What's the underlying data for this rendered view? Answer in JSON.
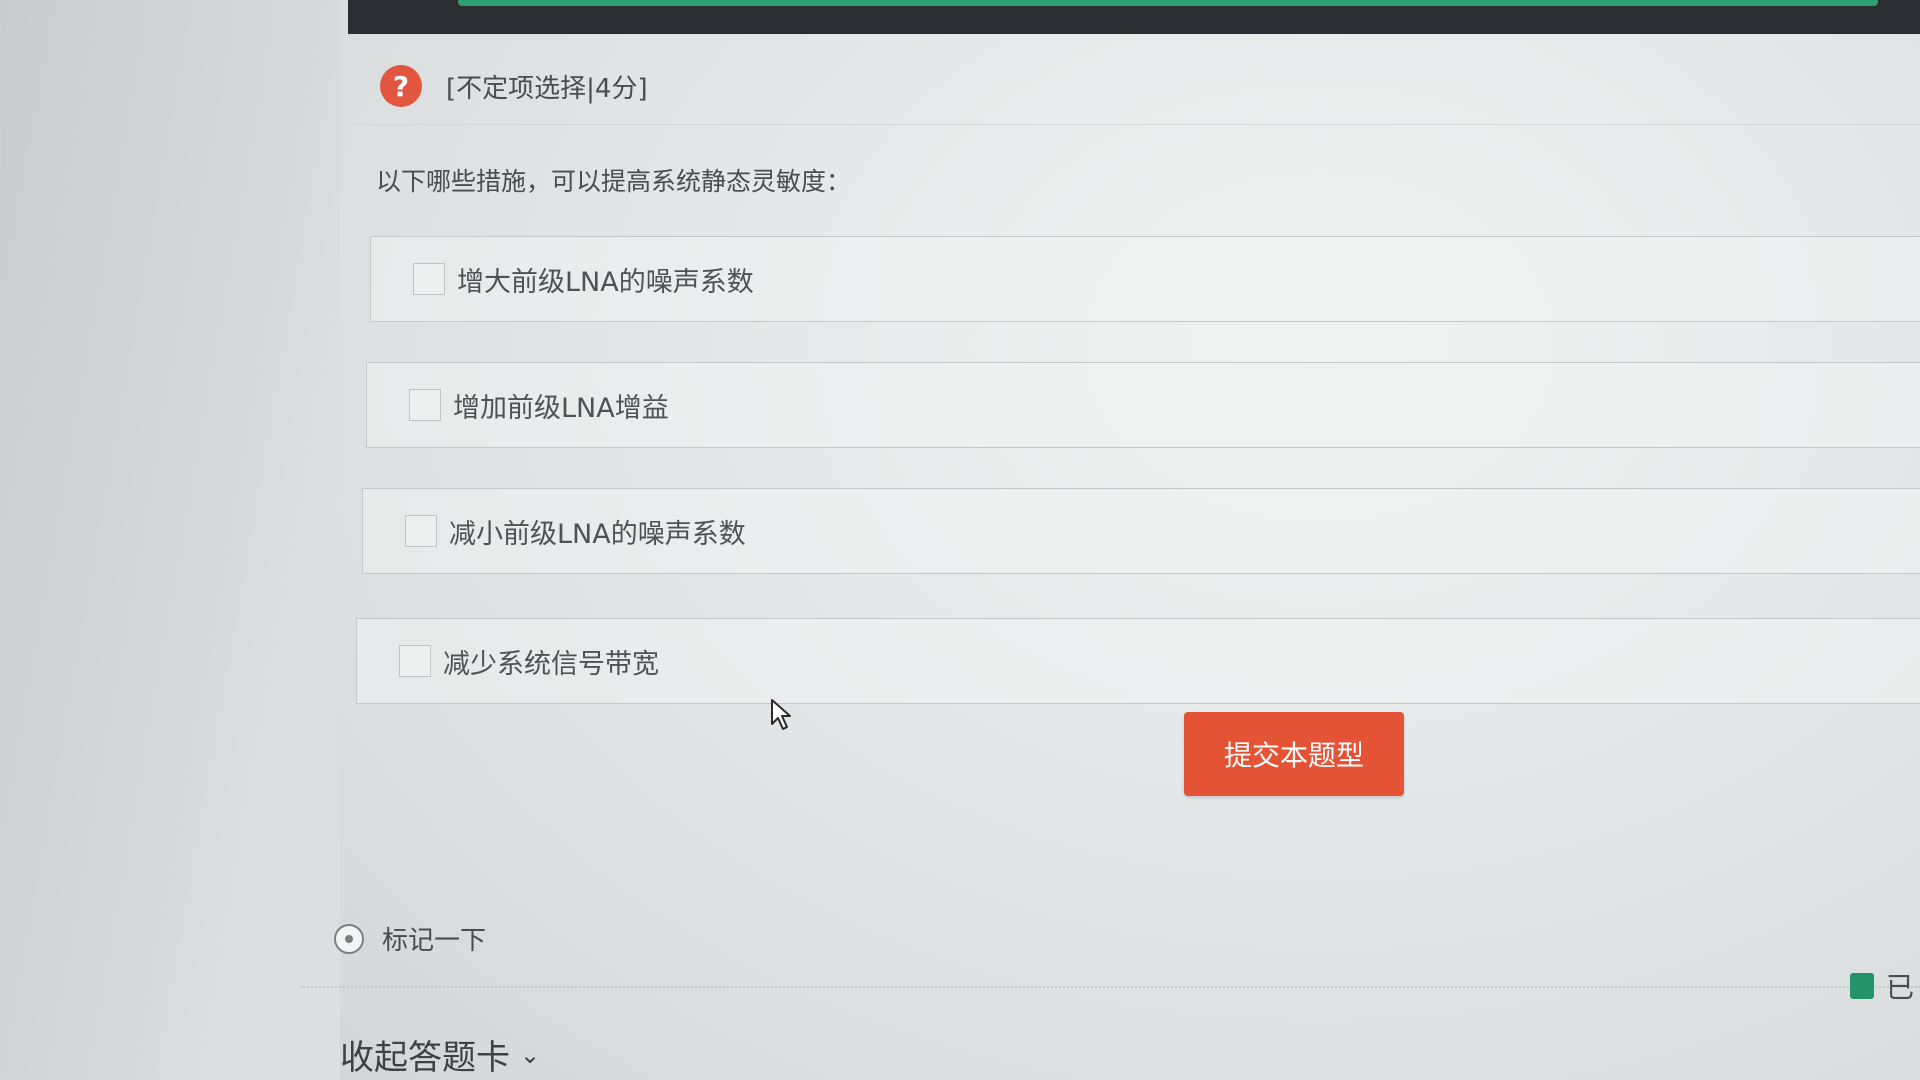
{
  "question": {
    "icon": "question-icon",
    "type_label": "[不定项选择|4分]",
    "text": "以下哪些措施，可以提高系统静态灵敏度：",
    "options": [
      {
        "label": "增大前级LNA的噪声系数",
        "checked": false
      },
      {
        "label": "增加前级LNA增益",
        "checked": false
      },
      {
        "label": "减小前级LNA的噪声系数",
        "checked": false
      },
      {
        "label": "减少系统信号带宽",
        "checked": false
      }
    ]
  },
  "actions": {
    "submit_label": "提交本题型",
    "mark_label": "标记一下"
  },
  "answer_card": {
    "collapse_label": "收起答题卡",
    "answered_label": "已",
    "answered_color": "#25936a"
  },
  "colors": {
    "accent": "#e55336",
    "topbar_accent": "#2f9e6e"
  }
}
